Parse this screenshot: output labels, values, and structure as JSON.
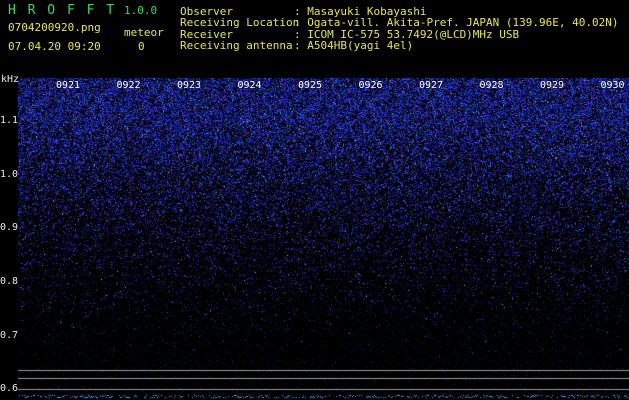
{
  "app": {
    "title": "H R O F F T",
    "version": "1.0.0"
  },
  "file": {
    "name": "0704200920.png",
    "datetime": "07.04.20 09:20"
  },
  "meteor": {
    "label": "meteor",
    "count": "0"
  },
  "info": {
    "observer": {
      "label": "Observer",
      "value": ": Masayuki Kobayashi"
    },
    "location": {
      "label": "Receiving Location",
      "value": ": Ogata-vill. Akita-Pref. JAPAN (139.96E, 40.02N)"
    },
    "receiver": {
      "label": "Receiver",
      "value": ": ICOM IC-575 53.7492(@LCD)MHz USB"
    },
    "antenna": {
      "label": "Receiving antenna",
      "value": ": A504HB(yagi 4el)"
    }
  },
  "colors": {
    "header_text": "#e8e840",
    "title_text": "#33dd55",
    "signal": "#3a55ff"
  },
  "chart_data": {
    "type": "heatmap",
    "ylabel": "kHz",
    "yticks": [
      "1.1",
      "1.0",
      "0.9",
      "0.8",
      "0.7",
      "0.6"
    ],
    "ylim": [
      0.58,
      1.18
    ],
    "time_labels": [
      "0921",
      "0922",
      "0923",
      "0924",
      "0925",
      "0926",
      "0927",
      "0928",
      "0929",
      "0930"
    ],
    "noise_density_profile": "high near top, fading toward bottom",
    "grid": false
  }
}
